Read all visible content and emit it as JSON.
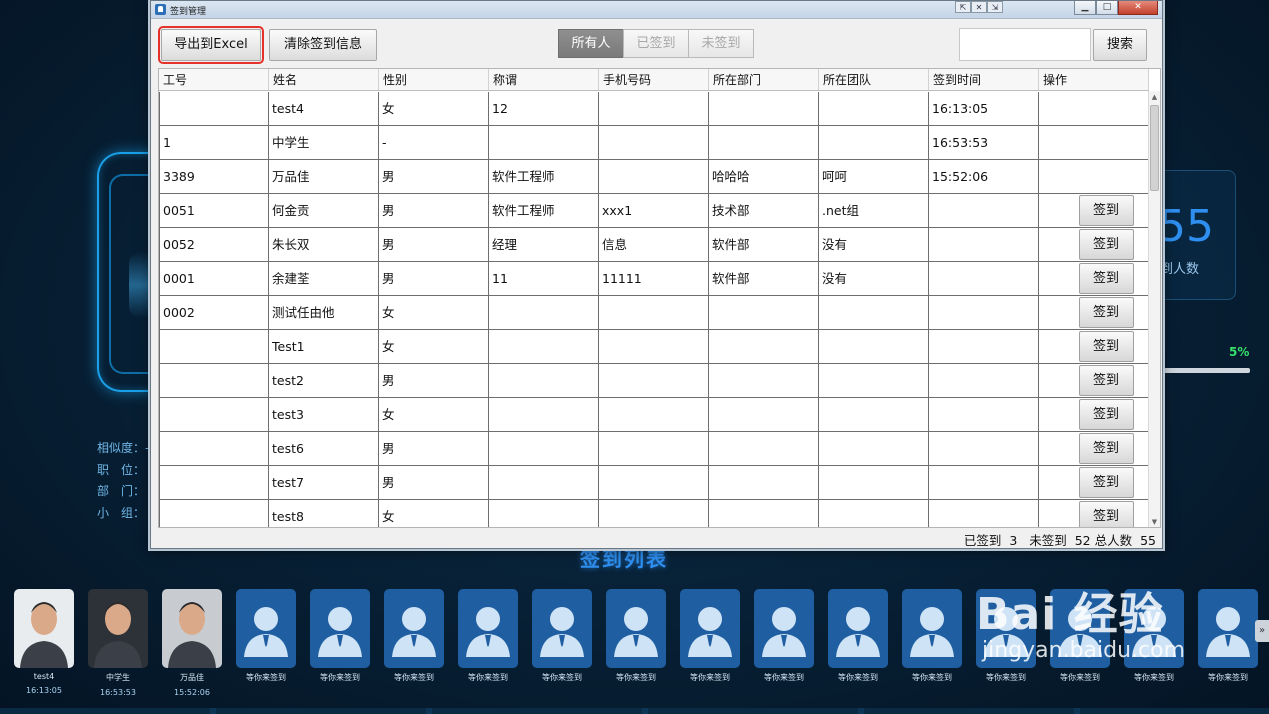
{
  "window": {
    "title": "签到管理",
    "controls": {
      "minimize": "▁",
      "maximize": "□",
      "close": "✕"
    },
    "float_controls": [
      "⇱",
      "✕",
      "⇲"
    ]
  },
  "toolbar": {
    "export_label": "导出到Excel",
    "clear_label": "清除签到信息",
    "filters": [
      "所有人",
      "已签到",
      "未签到"
    ],
    "active_filter": "所有人",
    "search_value": "",
    "search_label": "搜索"
  },
  "table": {
    "columns": [
      "工号",
      "姓名",
      "性别",
      "称谓",
      "手机号码",
      "所在部门",
      "所在团队",
      "签到时间",
      "操作"
    ],
    "sign_label": "签到",
    "rows": [
      {
        "id": "",
        "name": "test4",
        "gender": "女",
        "title": "12",
        "phone": "",
        "dept": "",
        "team": "",
        "time": "16:13:05",
        "action": ""
      },
      {
        "id": "1",
        "name": "中学生",
        "gender": "-",
        "title": "",
        "phone": "",
        "dept": "",
        "team": "",
        "time": "16:53:53",
        "action": ""
      },
      {
        "id": "3389",
        "name": "万品佳",
        "gender": "男",
        "title": "软件工程师",
        "phone": "",
        "dept": "哈哈哈",
        "team": "呵呵",
        "time": "15:52:06",
        "action": ""
      },
      {
        "id": "0051",
        "name": "何金贡",
        "gender": "男",
        "title": "软件工程师",
        "phone": "xxx1",
        "dept": "技术部",
        "team": ".net组",
        "time": "",
        "action": "签到"
      },
      {
        "id": "0052",
        "name": "朱长双",
        "gender": "男",
        "title": "经理",
        "phone": "信息",
        "dept": "软件部",
        "team": "没有",
        "time": "",
        "action": "签到"
      },
      {
        "id": "0001",
        "name": "余建荃",
        "gender": "男",
        "title": "11",
        "phone": "11111",
        "dept": "软件部",
        "team": "没有",
        "time": "",
        "action": "签到"
      },
      {
        "id": "0002",
        "name": "测试任由他",
        "gender": "女",
        "title": "",
        "phone": "",
        "dept": "",
        "team": "",
        "time": "",
        "action": "签到"
      },
      {
        "id": "",
        "name": "Test1",
        "gender": "女",
        "title": "",
        "phone": "",
        "dept": "",
        "team": "",
        "time": "",
        "action": "签到"
      },
      {
        "id": "",
        "name": "test2",
        "gender": "男",
        "title": "",
        "phone": "",
        "dept": "",
        "team": "",
        "time": "",
        "action": "签到"
      },
      {
        "id": "",
        "name": "test3",
        "gender": "女",
        "title": "",
        "phone": "",
        "dept": "",
        "team": "",
        "time": "",
        "action": "签到"
      },
      {
        "id": "",
        "name": "test6",
        "gender": "男",
        "title": "",
        "phone": "",
        "dept": "",
        "team": "",
        "time": "",
        "action": "签到"
      },
      {
        "id": "",
        "name": "test7",
        "gender": "男",
        "title": "",
        "phone": "",
        "dept": "",
        "team": "",
        "time": "",
        "action": "签到"
      },
      {
        "id": "",
        "name": "test8",
        "gender": "女",
        "title": "",
        "phone": "",
        "dept": "",
        "team": "",
        "time": "",
        "action": "签到"
      }
    ]
  },
  "status": {
    "signed_label": "已签到",
    "signed_count": "3",
    "unsigned_label": "未签到",
    "unsigned_count": "52",
    "total_label": "总人数",
    "total_count": "55"
  },
  "dashboard": {
    "info_labels": [
      "相似度：-",
      "职　位：",
      "部　门：",
      "小　组："
    ],
    "stat_number": "55",
    "stat_label": "到人数",
    "progress_text": "5%",
    "progress_fraction": 0.05,
    "list_title": "签到列表",
    "people": [
      {
        "name": "test4",
        "time": "16:13:05",
        "avatar": "photo"
      },
      {
        "name": "中学生",
        "time": "16:53:53",
        "avatar": "photo"
      },
      {
        "name": "万品佳",
        "time": "15:52:06",
        "avatar": "photo"
      },
      {
        "name": "等你来签到",
        "time": "",
        "avatar": "placeholder"
      },
      {
        "name": "等你来签到",
        "time": "",
        "avatar": "placeholder"
      },
      {
        "name": "等你来签到",
        "time": "",
        "avatar": "placeholder"
      },
      {
        "name": "等你来签到",
        "time": "",
        "avatar": "placeholder"
      },
      {
        "name": "等你来签到",
        "time": "",
        "avatar": "placeholder"
      },
      {
        "name": "等你来签到",
        "time": "",
        "avatar": "placeholder"
      },
      {
        "name": "等你来签到",
        "time": "",
        "avatar": "placeholder"
      },
      {
        "name": "等你来签到",
        "time": "",
        "avatar": "placeholder"
      },
      {
        "name": "等你来签到",
        "time": "",
        "avatar": "placeholder"
      },
      {
        "name": "等你来签到",
        "time": "",
        "avatar": "placeholder"
      },
      {
        "name": "等你来签到",
        "time": "",
        "avatar": "placeholder"
      },
      {
        "name": "等你来签到",
        "time": "",
        "avatar": "placeholder"
      },
      {
        "name": "等你来签到",
        "time": "",
        "avatar": "placeholder"
      },
      {
        "name": "等你来签到",
        "time": "",
        "avatar": "placeholder"
      }
    ],
    "next_arrow": "»"
  },
  "watermark": {
    "brand": "Bai 经验",
    "site": "jingyan.baidu.com"
  },
  "colors": {
    "accent_blue": "#2f90f2",
    "highlight_red": "#e4322b",
    "progress_green": "#36e06a"
  }
}
